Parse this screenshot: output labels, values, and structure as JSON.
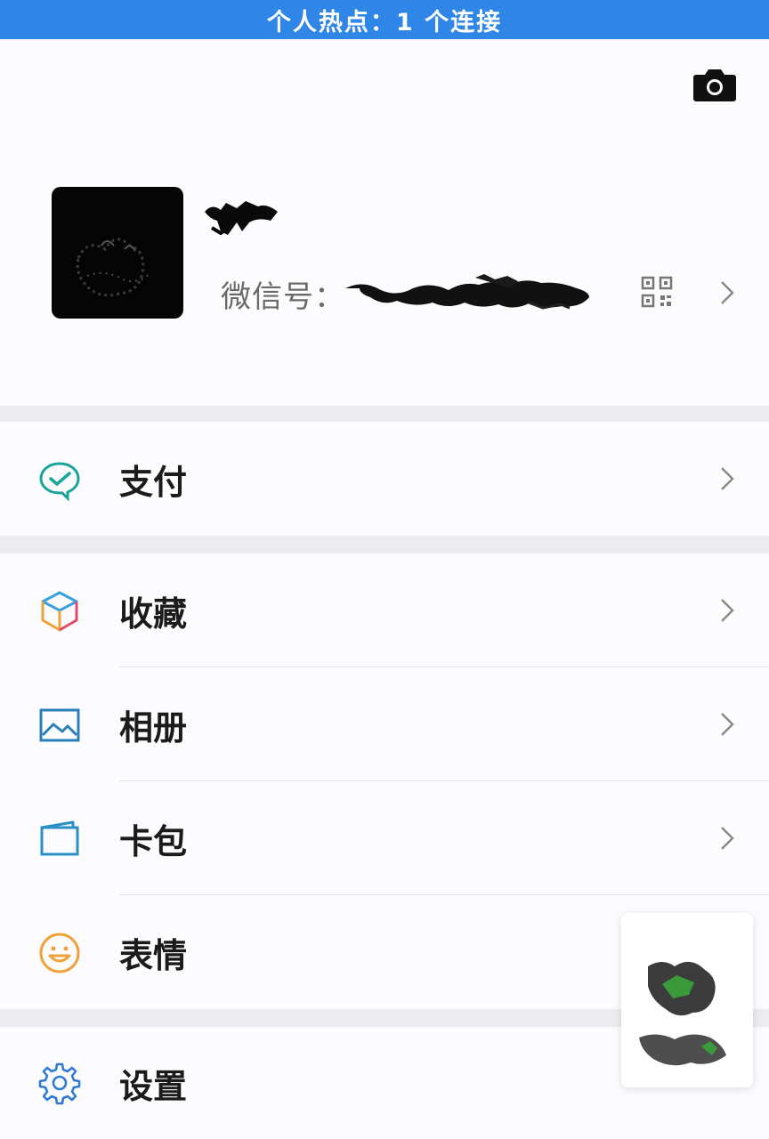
{
  "status_bar": {
    "hotspot_text": "个人热点：1 个连接"
  },
  "profile": {
    "wechat_id_label": "微信号："
  },
  "menu": {
    "pay": "支付",
    "favorites": "收藏",
    "album": "相册",
    "cards": "卡包",
    "stickers": "表情",
    "settings": "设置"
  },
  "colors": {
    "status_bar_bg": "#2f86e6",
    "pay_icon": "#1aa39a",
    "album_icon": "#2a7fb8",
    "cards_icon": "#2a8fc7",
    "stickers_icon": "#f0a13a",
    "settings_icon": "#2f7bd6"
  },
  "icons": {
    "camera": "camera-icon",
    "qr": "qr-code-icon",
    "chevron": "chevron-right-icon",
    "pay": "pay-icon",
    "favorites": "cube-icon",
    "album": "picture-icon",
    "cards": "wallet-icon",
    "stickers": "smiley-icon",
    "settings": "gear-icon"
  }
}
